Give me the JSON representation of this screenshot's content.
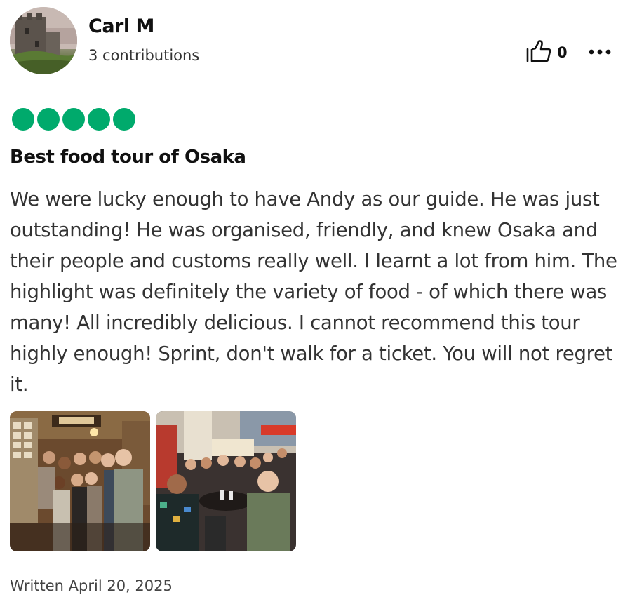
{
  "reviewer": {
    "name": "Carl M",
    "contributions": "3 contributions"
  },
  "actions": {
    "helpful_count": "0",
    "helpful_icon": "thumbs-up-icon",
    "more_icon": "more-dots-icon"
  },
  "rating": {
    "bubbles": 5,
    "out_of": 5,
    "color": "#00aa6c"
  },
  "review": {
    "title": "Best food tour of Osaka",
    "body": "We were lucky enough to have Andy as our guide. He was just outstanding! He was organised, friendly, and knew Osaka and their people and customs really well. I learnt a lot from him. The highlight was definitely the variety of food - of which there was many! All incredibly delicious. I cannot recommend this tour highly enough! Sprint, don't walk for a ticket. You will not regret it.",
    "written": "Written April 20, 2025"
  },
  "photos": [
    {
      "label": "review-photo-1"
    },
    {
      "label": "review-photo-2"
    }
  ]
}
